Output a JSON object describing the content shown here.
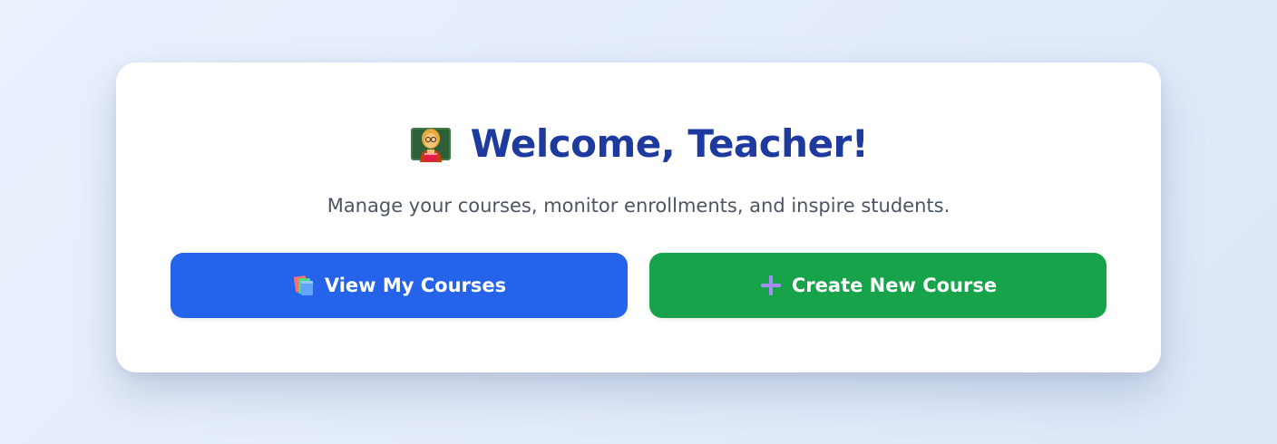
{
  "header": {
    "title": "Welcome, Teacher!",
    "icon": "teacher-icon",
    "title_color": "#1e3a9f"
  },
  "subtitle": "Manage your courses, monitor enrollments, and inspire students.",
  "actions": {
    "view_courses": {
      "label": "View My Courses",
      "icon": "books-icon",
      "color": "#2563eb"
    },
    "create_course": {
      "label": "Create New Course",
      "icon": "plus-icon",
      "color": "#16a34a"
    }
  }
}
